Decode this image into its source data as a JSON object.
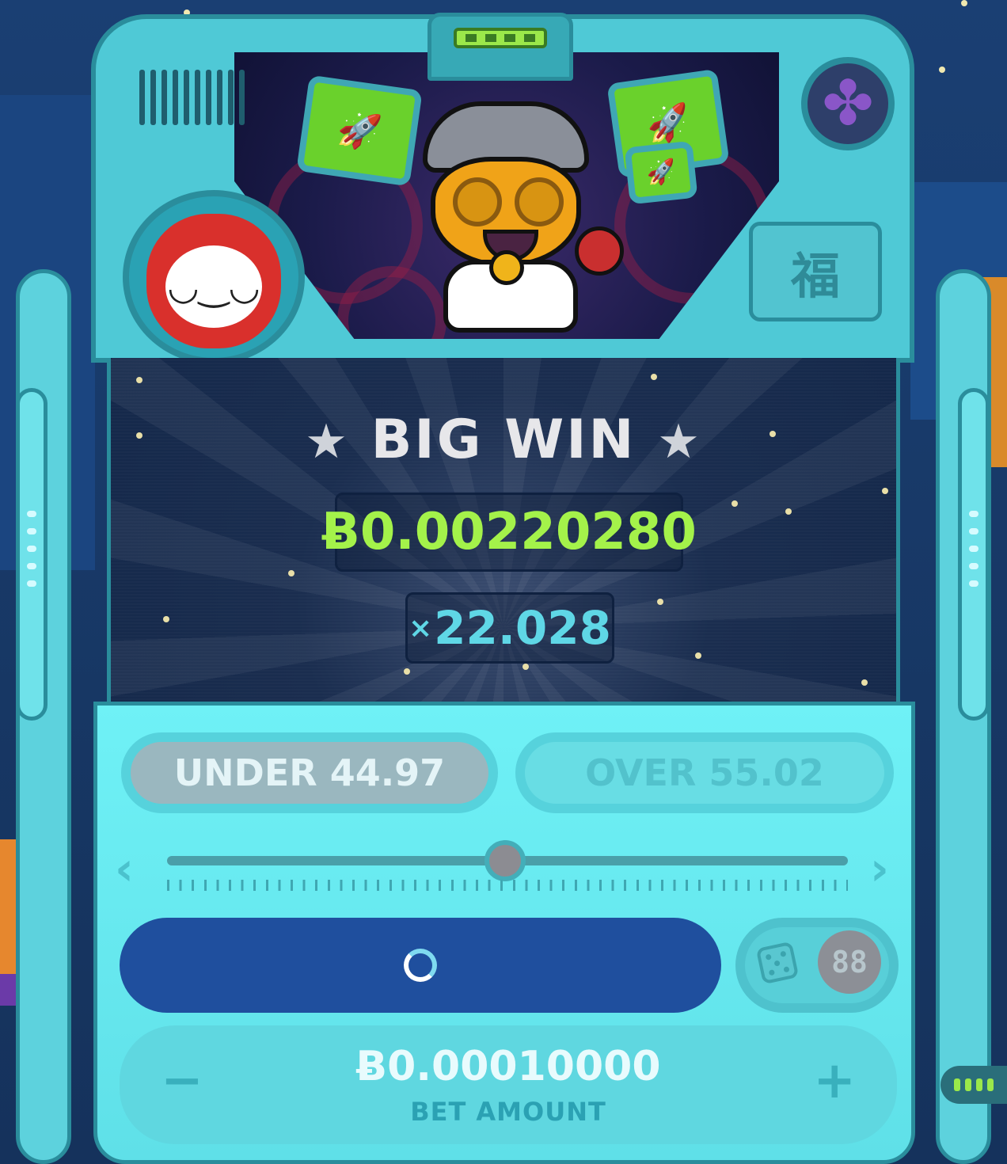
{
  "result": {
    "title": "BIG WIN",
    "star_glyph": "★",
    "payout": "Ƀ0.00220280",
    "multiplier_symbol": "×",
    "multiplier": "22.028"
  },
  "machine": {
    "fortune_character": "福",
    "screen_icon": "🚀"
  },
  "controls": {
    "under_label": "UNDER 44.97",
    "over_label": "OVER 55.02",
    "selected": "under",
    "slider_value": 0.497,
    "auto_count": "88",
    "roll_state": "loading",
    "bet_minus": "−",
    "bet_plus": "+",
    "bet_amount": "Ƀ0.00010000",
    "bet_label": "BET AMOUNT",
    "prev_arrow": "‹",
    "next_arrow": "›"
  },
  "colors": {
    "payout_green": "#a4f24a",
    "multiplier_cyan": "#5fd7e6",
    "roll_button_blue": "#1f4f9e",
    "panel_cyan": "#6ff1f6"
  }
}
